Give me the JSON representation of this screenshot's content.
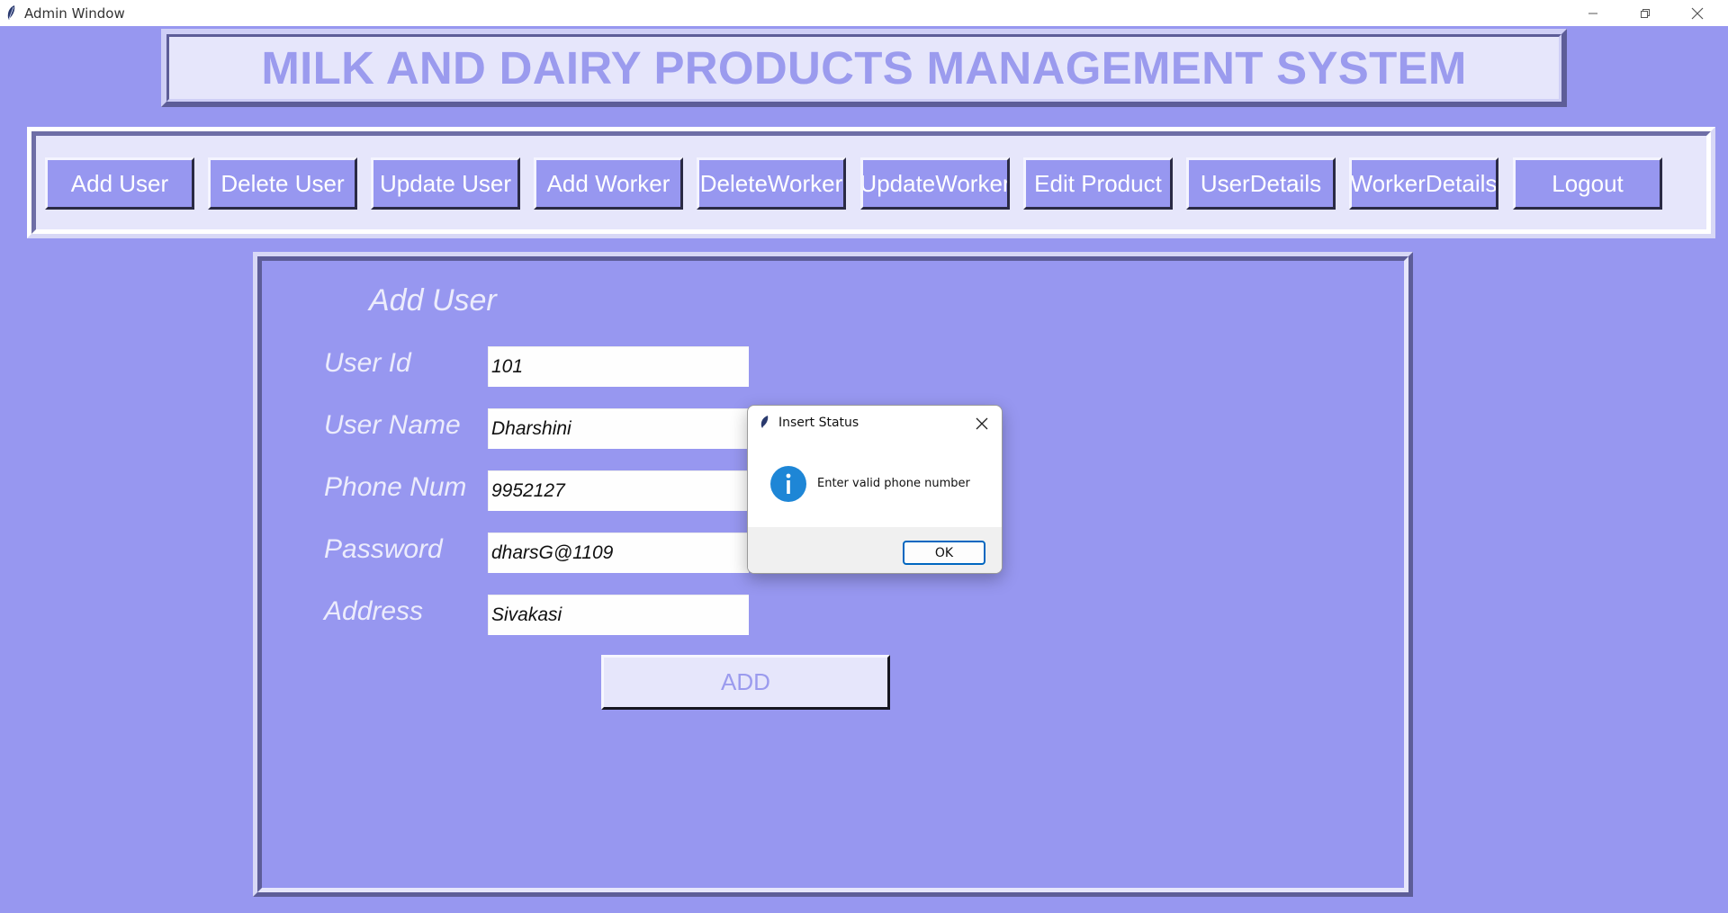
{
  "window": {
    "title": "Admin Window",
    "controls": [
      "minimize-icon",
      "restore-icon",
      "close-icon"
    ]
  },
  "header": {
    "title": "MILK AND DAIRY PRODUCTS MANAGEMENT SYSTEM"
  },
  "nav": {
    "buttons": [
      {
        "label": "Add User"
      },
      {
        "label": "Delete User"
      },
      {
        "label": "Update User"
      },
      {
        "label": "Add Worker"
      },
      {
        "label": "DeleteWorker"
      },
      {
        "label": "UpdateWorker"
      },
      {
        "label": "Edit Product"
      },
      {
        "label": "UserDetails"
      },
      {
        "label": "WorkerDetails"
      },
      {
        "label": "Logout"
      }
    ]
  },
  "form": {
    "heading": "Add User",
    "fields": [
      {
        "label": "User Id",
        "value": "101"
      },
      {
        "label": "User Name",
        "value": "Dharshini"
      },
      {
        "label": "Phone Num",
        "value": "9952127"
      },
      {
        "label": "Password",
        "value": "dharsG@1109"
      },
      {
        "label": "Address",
        "value": "Sivakasi"
      }
    ],
    "submit_label": "ADD"
  },
  "dialog": {
    "title": "Insert Status",
    "message": "Enter valid phone number",
    "ok_label": "OK",
    "icon": "info-icon"
  },
  "colors": {
    "background": "#9797f0",
    "panel": "#e6e6fb",
    "title_text": "#9b9bee",
    "label_text": "#ececfc",
    "dialog_accent": "#0067c0",
    "info_icon": "#1e86d6"
  }
}
